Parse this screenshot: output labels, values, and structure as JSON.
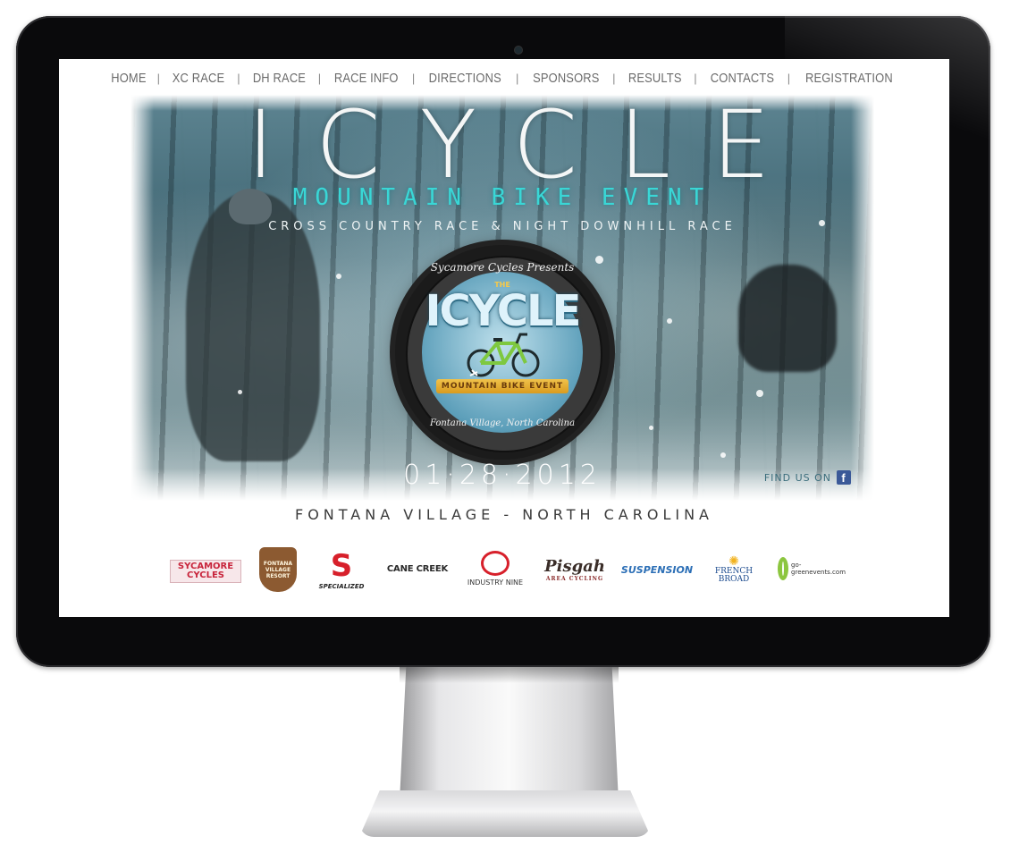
{
  "nav": {
    "items": [
      "HOME",
      "XC RACE",
      "DH RACE",
      "RACE INFO",
      "DIRECTIONS",
      "SPONSORS",
      "RESULTS",
      "CONTACTS",
      "REGISTRATION"
    ],
    "separator": "|"
  },
  "hero": {
    "title": "ICYCLE",
    "subtitle": "MOUNTAIN BIKE EVENT",
    "tagline": "CROSS COUNTRY RACE & NIGHT DOWNHILL RACE",
    "date": "01·28·2012",
    "find_us": "FIND US ON",
    "facebook_icon": "facebook-icon"
  },
  "badge": {
    "top_text": "Sycamore Cycles Presents",
    "the": "THE",
    "name": "ICYCLE",
    "ribbon": "MOUNTAIN BIKE EVENT",
    "bottom_text": "Fontana Village, North Carolina"
  },
  "location": "FONTANA VILLAGE - NORTH CAROLINA",
  "sponsors": {
    "sycamore": [
      "SYCAMORE",
      "CYCLES"
    ],
    "fontana": [
      "FONTANA",
      "VILLAGE",
      "RESORT"
    ],
    "specialized": "SPECIALIZED",
    "canecreek": "CANE CREEK",
    "industry_nine": "INDUSTRY NINE",
    "pisgah": "Pisgah",
    "pisgah_sub": "AREA CYCLING",
    "suspension": "SUSPENSION",
    "french_broad": [
      "FRENCH",
      "BROAD"
    ],
    "gogreen": "go-greenevents.com"
  },
  "colors": {
    "nav_text": "#6b6b6b",
    "accent_cyan": "#39d7d6",
    "bezel": "#0a0a0c",
    "facebook": "#3b5998"
  }
}
